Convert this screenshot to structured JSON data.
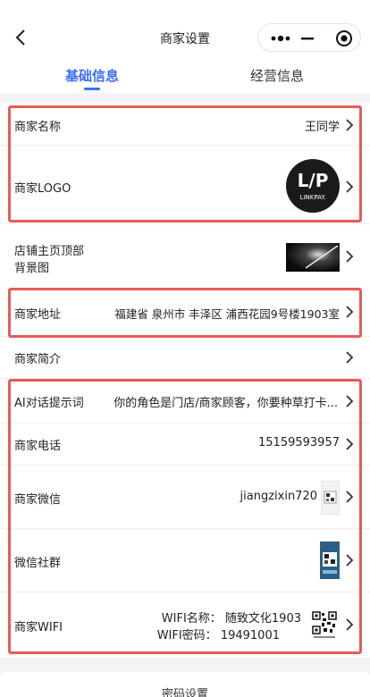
{
  "nav": {
    "title": "商家设置"
  },
  "tabs": [
    {
      "label": "基础信息",
      "active": true
    },
    {
      "label": "经营信息",
      "active": false
    }
  ],
  "rows": {
    "name": {
      "label": "商家名称",
      "value": "王同学"
    },
    "logo": {
      "label": "商家LOGO",
      "logo_text": "LINKPAY."
    },
    "banner": {
      "label_line1": "店铺主页顶部",
      "label_line2": "背景图"
    },
    "address": {
      "label": "商家地址",
      "value": "福建省 泉州市 丰泽区 浦西花园9号楼1903室"
    },
    "intro": {
      "label": "商家简介"
    },
    "ai": {
      "label": "AI对话提示词",
      "value": "你的角色是门店/商家顾客，你要种草打卡..."
    },
    "phone": {
      "label": "商家电话",
      "value": "15159593957"
    },
    "wechat": {
      "label": "商家微信",
      "value": "jiangzixin720"
    },
    "group": {
      "label": "微信社群"
    },
    "wifi": {
      "label": "商家WIFI",
      "name_line": "WIFI名称：  随致文化1903",
      "pwd_line": "WIFI密码：  19491001"
    }
  },
  "footer": {
    "label": "密码设置"
  },
  "colors": {
    "accent": "#3d6ef5",
    "highlight_border": "#ea5a5a"
  }
}
